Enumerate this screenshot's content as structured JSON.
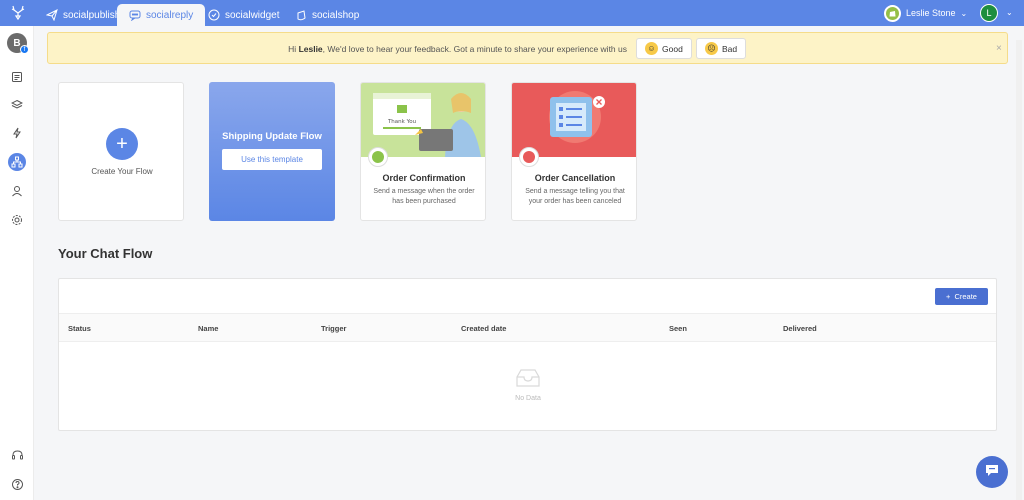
{
  "topbar": {
    "tabs": [
      {
        "label": "socialpublish",
        "icon": "paper-plane-icon"
      },
      {
        "label": "socialreply",
        "icon": "chat-reply-icon"
      },
      {
        "label": "socialwidget",
        "icon": "widget-icon"
      },
      {
        "label": "socialshop",
        "icon": "shop-bag-icon"
      }
    ],
    "user_name": "Leslie Stone",
    "avatar_initial": "L"
  },
  "sidebar": {
    "account_initial": "B",
    "fb_badge": "f",
    "items": [
      "content-icon",
      "layers-icon",
      "bolt-icon",
      "flow-icon",
      "user-icon",
      "settings-icon",
      "support-icon",
      "help-icon"
    ]
  },
  "notice": {
    "greeting": "Hi ",
    "name": "Leslie",
    "message": ", We'd love to hear your feedback. Got a minute to share your experience with us",
    "good_label": "Good",
    "bad_label": "Bad"
  },
  "cards": {
    "create_label": "Create Your Flow",
    "shipping_title": "Shipping Update Flow",
    "shipping_button": "Use this template",
    "confirm_title": "Order Confirmation",
    "confirm_desc": "Send a message when the order has been purchased",
    "confirm_img_text": "Thank You",
    "cancel_title": "Order Cancellation",
    "cancel_desc": "Send a message telling you that your order has been canceled"
  },
  "chat_flow": {
    "title": "Your Chat Flow",
    "create_label": "Create",
    "columns": [
      "Status",
      "Name",
      "Trigger",
      "Created date",
      "Seen",
      "Delivered"
    ],
    "empty_text": "No Data"
  },
  "colors": {
    "primary": "#5b86e5",
    "button": "#4a6fd1",
    "notice_bg": "#fdf3c7",
    "confirm_green": "#8bc34a",
    "cancel_red": "#e85a5a"
  }
}
